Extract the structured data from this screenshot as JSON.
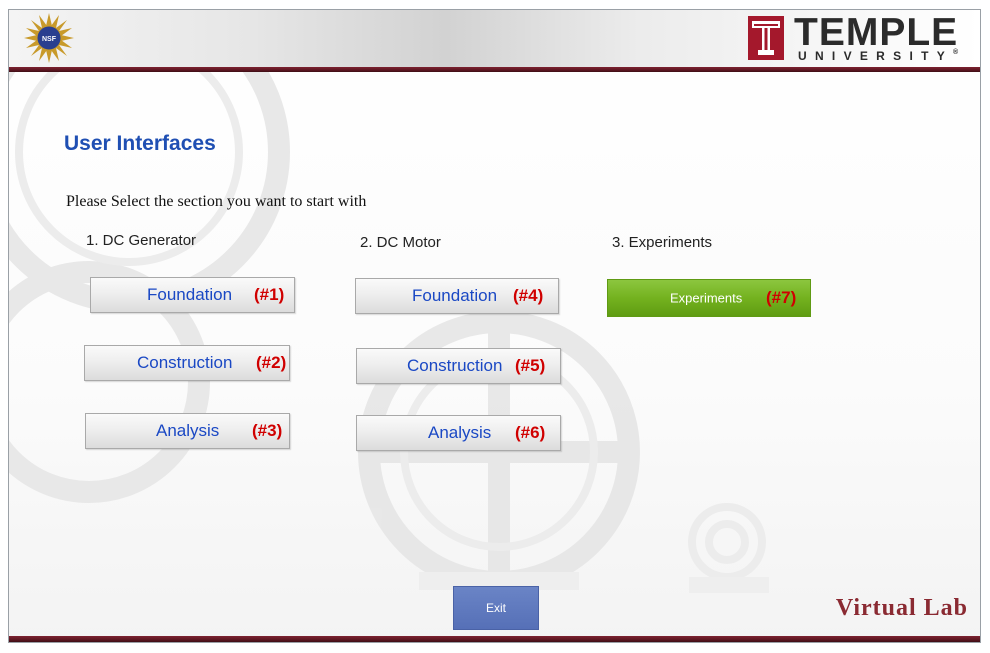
{
  "header": {
    "left_logo": "nsf-seal",
    "left_logo_text": "NSF",
    "right_logo_wordmark": "TEMPLE",
    "right_logo_subtitle": "UNIVERSITY",
    "right_logo_registered": "®"
  },
  "page": {
    "title": "User Interfaces",
    "prompt": "Please Select the section you want to start with"
  },
  "columns": [
    {
      "heading": "1. DC Generator",
      "buttons": [
        {
          "label": "Foundation",
          "number": "(#1)"
        },
        {
          "label": "Construction",
          "number": "(#2)"
        },
        {
          "label": "Analysis",
          "number": "(#3)"
        }
      ]
    },
    {
      "heading": "2. DC Motor",
      "buttons": [
        {
          "label": "Foundation",
          "number": "(#4)"
        },
        {
          "label": "Construction",
          "number": "(#5)"
        },
        {
          "label": "Analysis",
          "number": "(#6)"
        }
      ]
    },
    {
      "heading": "3. Experiments",
      "buttons": [
        {
          "label": "Experiments",
          "number": "(#7)"
        }
      ]
    }
  ],
  "footer": {
    "exit_label": "Exit",
    "brand": "Virtual Lab"
  },
  "colors": {
    "accent_maroon": "#7d2231",
    "title_blue": "#1f4fb3",
    "button_text_blue": "#1a48c4",
    "number_red": "#d00000",
    "experiments_green": "#74b21f",
    "exit_blue": "#5670b7"
  }
}
